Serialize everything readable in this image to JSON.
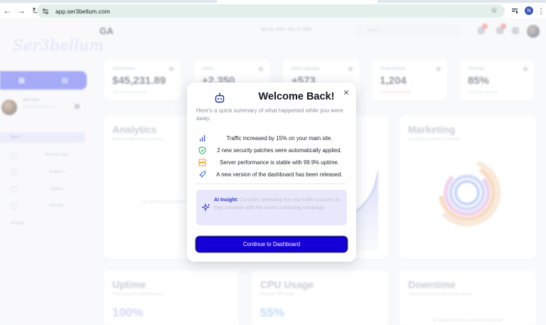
{
  "browser": {
    "url": "app.ser3bellum.com",
    "profile_initial": "N"
  },
  "app": {
    "logo_text": "Ser3bellum",
    "page_title": "GA",
    "date_range": "Nov 11, 2025 - Nov 17, 2025",
    "search_placeholder": "Search...",
    "user": {
      "name": "Alvin Doe",
      "meta": "alvin@ser3bellum.com"
    },
    "sidebar": {
      "open_section": "Open",
      "items": [
        {
          "label": "Refresh Data"
        },
        {
          "label": "Analytics"
        },
        {
          "label": "Uptime"
        },
        {
          "label": "Security"
        }
      ],
      "settings_label": "Settings"
    },
    "stats": [
      {
        "label": "Total Revenue",
        "value": "$45,231.89",
        "change": "+20.1% from last month"
      },
      {
        "label": "Visitors",
        "value": "+2,350",
        "change": "+180.1% from last month"
      },
      {
        "label": "Active Campaigns",
        "value": "+573",
        "change": "+201 since last hour"
      },
      {
        "label": "Threats Blocked",
        "value": "1,204",
        "change": "-4.5% from last month"
      },
      {
        "label": "CPU Peak",
        "value": "85%",
        "change": "+5.2% from last hour"
      }
    ],
    "panels": {
      "analytics": {
        "title": "Analytics",
        "subtitle": "Website traffic for the past week",
        "empty": "No analytics data available"
      },
      "marketing": {
        "title": "Marketing",
        "subtitle": "Campaign performance overview"
      },
      "uptime": {
        "title": "Uptime",
        "subtitle": "Performance for selected period",
        "value": "100%"
      },
      "cpu": {
        "title": "CPU Usage",
        "subtitle": "Real-time CPU usage",
        "value": "55%"
      },
      "downtime": {
        "title": "Downtime",
        "subtitle": "Downtime events for the selected period",
        "empty": "No downtime events recorded for this period"
      }
    }
  },
  "modal": {
    "title": "Welcome Back!",
    "subtitle": "Here's a quick summary of what happened while you were away.",
    "updates": [
      {
        "icon": "bar-chart-icon",
        "text": "Traffic increased by 15% on your main site."
      },
      {
        "icon": "shield-check-icon",
        "text": "2 new security patches were automatically applied."
      },
      {
        "icon": "server-icon",
        "text": "Server performance is stable with 99.9% uptime."
      },
      {
        "icon": "rocket-icon",
        "text": "A new version of the dashboard has been released."
      }
    ],
    "insight_label": "AI Insight:",
    "insight_text": "Consider reviewing the new traffic sources as they correlate with the recent marketing campaign.",
    "cta_label": "Continue to Dashboard"
  },
  "colors": {
    "primary": "#1500d6",
    "insight_bg": "#e9e7fb",
    "insight_label": "#2f3ab8",
    "shield": "#2eb872",
    "server": "#f0a020",
    "chart_accent": "#4f6bd9"
  }
}
